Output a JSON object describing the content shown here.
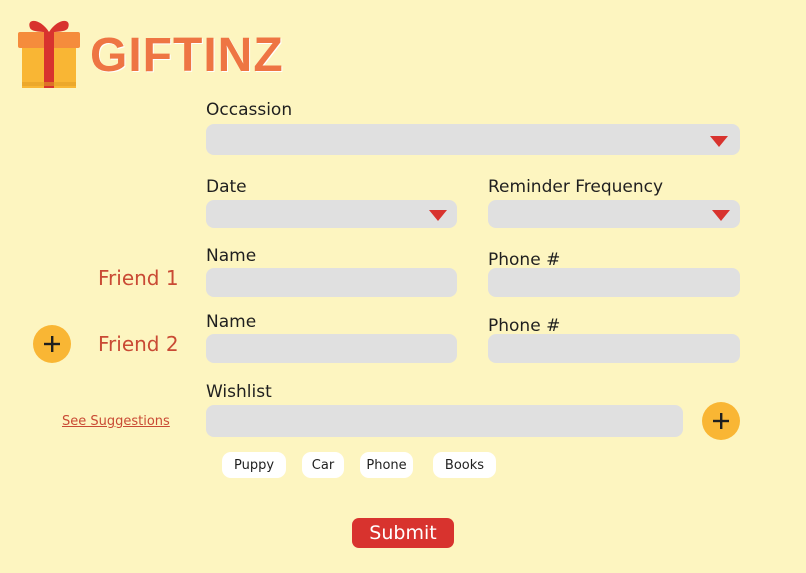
{
  "brand": {
    "name": "GIFTINZ",
    "logo_icon": "gift-box-icon"
  },
  "occasion": {
    "label": "Occassion",
    "value": ""
  },
  "date": {
    "label": "Date",
    "value": ""
  },
  "reminder": {
    "label": "Reminder Frequency",
    "value": ""
  },
  "friends": [
    {
      "label": "Friend 1",
      "name_label": "Name",
      "phone_label": "Phone #",
      "name_value": "",
      "phone_value": ""
    },
    {
      "label": "Friend 2",
      "name_label": "Name",
      "phone_label": "Phone #",
      "name_value": "",
      "phone_value": ""
    }
  ],
  "add_friend_icon": "plus-icon",
  "wishlist": {
    "label": "Wishlist",
    "value": "",
    "see_suggestions": "See Suggestions",
    "add_icon": "plus-icon",
    "suggestions": [
      "Puppy",
      "Car",
      "Phone",
      "Books"
    ]
  },
  "submit_label": "Submit",
  "colors": {
    "background": "#fdf5c0",
    "brand": "#ee7543",
    "accent_red": "#d8332e",
    "button_yellow": "#f9b634",
    "field_gray": "#e0e0e0"
  }
}
